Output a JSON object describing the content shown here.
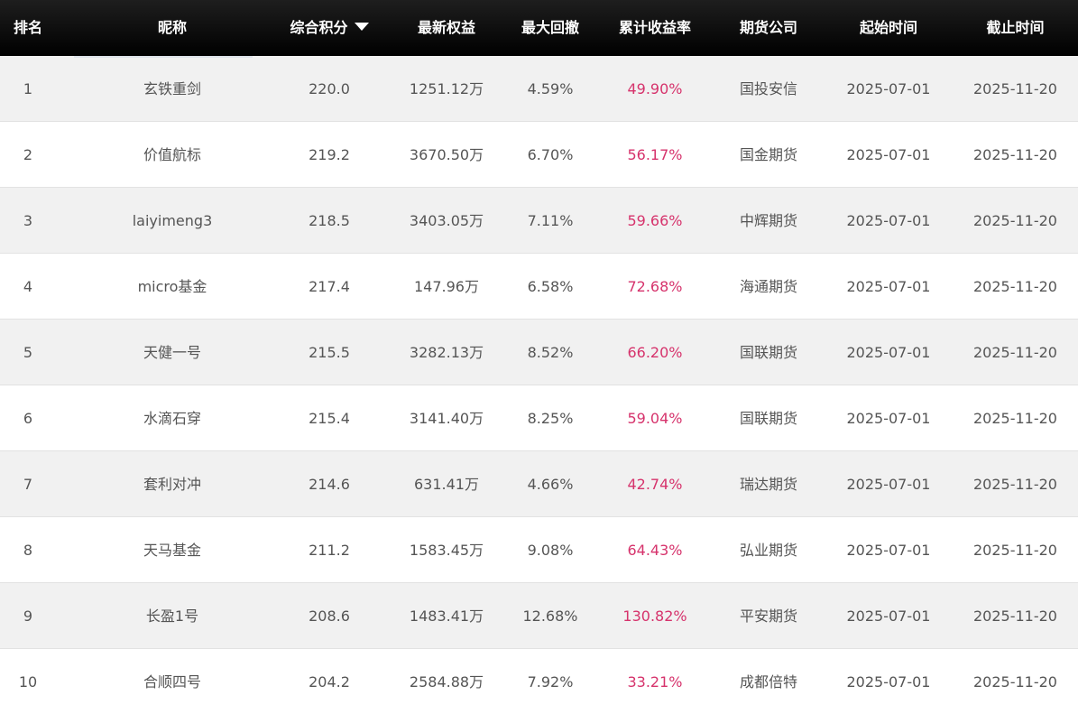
{
  "columns": {
    "rank": "排名",
    "name": "昵称",
    "score": "综合积分",
    "equity": "最新权益",
    "drawdown": "最大回撤",
    "return": "累计收益率",
    "company": "期货公司",
    "start": "起始时间",
    "end": "截止时间"
  },
  "sort": {
    "column": "score",
    "direction": "desc",
    "icon": "triangle-down-icon"
  },
  "colors": {
    "header_bg": "#000000",
    "stripe": "#f1f1f1",
    "return_text": "#d6336c"
  },
  "rows": [
    {
      "rank": "1",
      "name": "玄铁重剑",
      "score": "220.0",
      "equity": "1251.12万",
      "drawdown": "4.59%",
      "return": "49.90%",
      "company": "国投安信",
      "start": "2025-07-01",
      "end": "2025-11-20"
    },
    {
      "rank": "2",
      "name": "价值航标",
      "score": "219.2",
      "equity": "3670.50万",
      "drawdown": "6.70%",
      "return": "56.17%",
      "company": "国金期货",
      "start": "2025-07-01",
      "end": "2025-11-20"
    },
    {
      "rank": "3",
      "name": "laiyimeng3",
      "score": "218.5",
      "equity": "3403.05万",
      "drawdown": "7.11%",
      "return": "59.66%",
      "company": "中辉期货",
      "start": "2025-07-01",
      "end": "2025-11-20"
    },
    {
      "rank": "4",
      "name": "micro基金",
      "score": "217.4",
      "equity": "147.96万",
      "drawdown": "6.58%",
      "return": "72.68%",
      "company": "海通期货",
      "start": "2025-07-01",
      "end": "2025-11-20"
    },
    {
      "rank": "5",
      "name": "天健一号",
      "score": "215.5",
      "equity": "3282.13万",
      "drawdown": "8.52%",
      "return": "66.20%",
      "company": "国联期货",
      "start": "2025-07-01",
      "end": "2025-11-20"
    },
    {
      "rank": "6",
      "name": "水滴石穿",
      "score": "215.4",
      "equity": "3141.40万",
      "drawdown": "8.25%",
      "return": "59.04%",
      "company": "国联期货",
      "start": "2025-07-01",
      "end": "2025-11-20"
    },
    {
      "rank": "7",
      "name": "套利对冲",
      "score": "214.6",
      "equity": "631.41万",
      "drawdown": "4.66%",
      "return": "42.74%",
      "company": "瑞达期货",
      "start": "2025-07-01",
      "end": "2025-11-20"
    },
    {
      "rank": "8",
      "name": "天马基金",
      "score": "211.2",
      "equity": "1583.45万",
      "drawdown": "9.08%",
      "return": "64.43%",
      "company": "弘业期货",
      "start": "2025-07-01",
      "end": "2025-11-20"
    },
    {
      "rank": "9",
      "name": "长盈1号",
      "score": "208.6",
      "equity": "1483.41万",
      "drawdown": "12.68%",
      "return": "130.82%",
      "company": "平安期货",
      "start": "2025-07-01",
      "end": "2025-11-20"
    },
    {
      "rank": "10",
      "name": "合顺四号",
      "score": "204.2",
      "equity": "2584.88万",
      "drawdown": "7.92%",
      "return": "33.21%",
      "company": "成都倍特",
      "start": "2025-07-01",
      "end": "2025-11-20"
    }
  ]
}
